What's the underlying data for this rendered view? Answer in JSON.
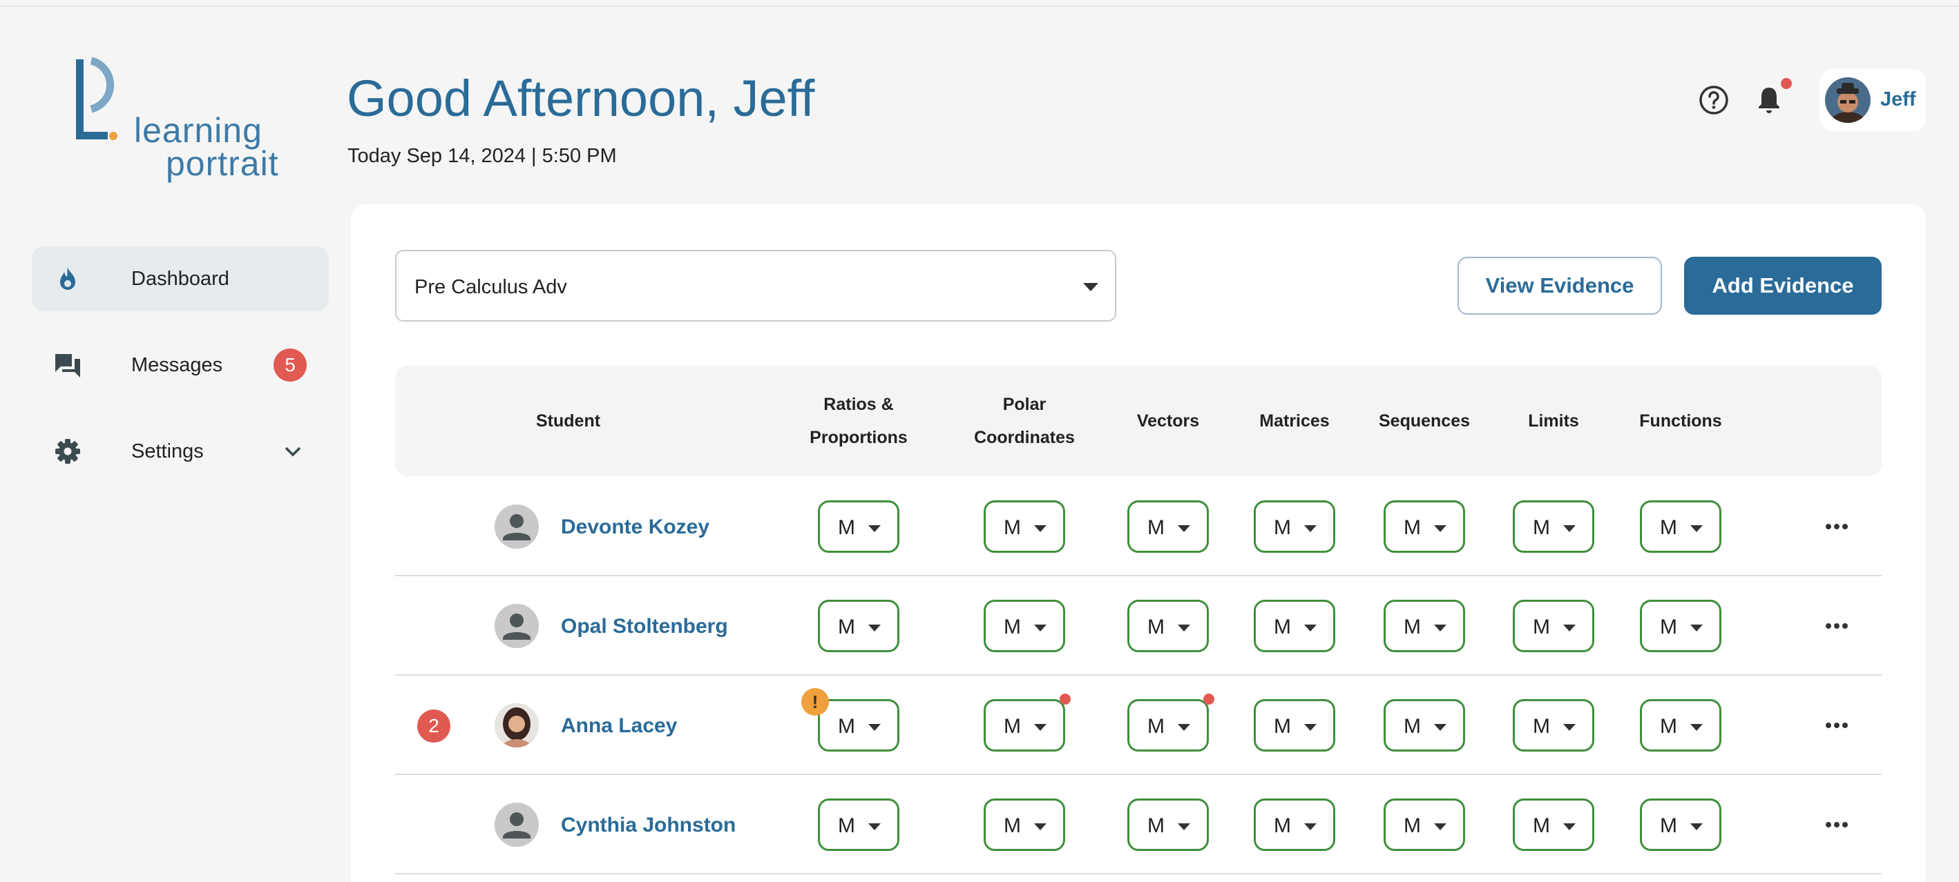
{
  "brand": {
    "line1": "learning",
    "line2": "portrait",
    "colors": {
      "blue": "#3d7aa7",
      "orange": "#f0a03c"
    }
  },
  "sidebar": {
    "items": [
      {
        "label": "Dashboard",
        "icon": "flame-icon",
        "active": true
      },
      {
        "label": "Messages",
        "icon": "chat-icon",
        "badge": "5"
      },
      {
        "label": "Settings",
        "icon": "gear-icon",
        "expand_icon": "chevron-down-icon"
      }
    ]
  },
  "header": {
    "greeting": "Good Afternoon, Jeff",
    "date": "Today Sep 14, 2024 | 5:50 PM",
    "icons": [
      "help-icon",
      "bell-icon"
    ],
    "notification_dot": true,
    "user": {
      "name": "Jeff"
    }
  },
  "toolbar": {
    "course": "Pre Calculus Adv",
    "view_evidence": "View Evidence",
    "add_evidence": "Add Evidence"
  },
  "table": {
    "student_header": "Student",
    "columns": [
      {
        "line1": "Ratios &",
        "line2": "Proportions"
      },
      {
        "line1": "Polar",
        "line2": "Coordinates"
      },
      {
        "line1": "Vectors",
        "line2": ""
      },
      {
        "line1": "Matrices",
        "line2": ""
      },
      {
        "line1": "Sequences",
        "line2": ""
      },
      {
        "line1": "Limits",
        "line2": ""
      },
      {
        "line1": "Functions",
        "line2": ""
      }
    ],
    "rows": [
      {
        "name": "Devonte Kozey",
        "badge": "",
        "grades": [
          "M",
          "M",
          "M",
          "M",
          "M",
          "M",
          "M"
        ]
      },
      {
        "name": "Opal Stoltenberg",
        "badge": "",
        "grades": [
          "M",
          "M",
          "M",
          "M",
          "M",
          "M",
          "M"
        ]
      },
      {
        "name": "Anna Lacey",
        "badge": "2",
        "warning": "!",
        "grades": [
          "M",
          "M",
          "M",
          "M",
          "M",
          "M",
          "M"
        ]
      },
      {
        "name": "Cynthia Johnston",
        "badge": "",
        "grades": [
          "M",
          "M",
          "M",
          "M",
          "M",
          "M",
          "M"
        ]
      }
    ]
  },
  "colors": {
    "primary": "#2a6b98",
    "grade_border": "#3f8f3a",
    "alert": "#e15a52",
    "warning": "#f0a03c"
  }
}
